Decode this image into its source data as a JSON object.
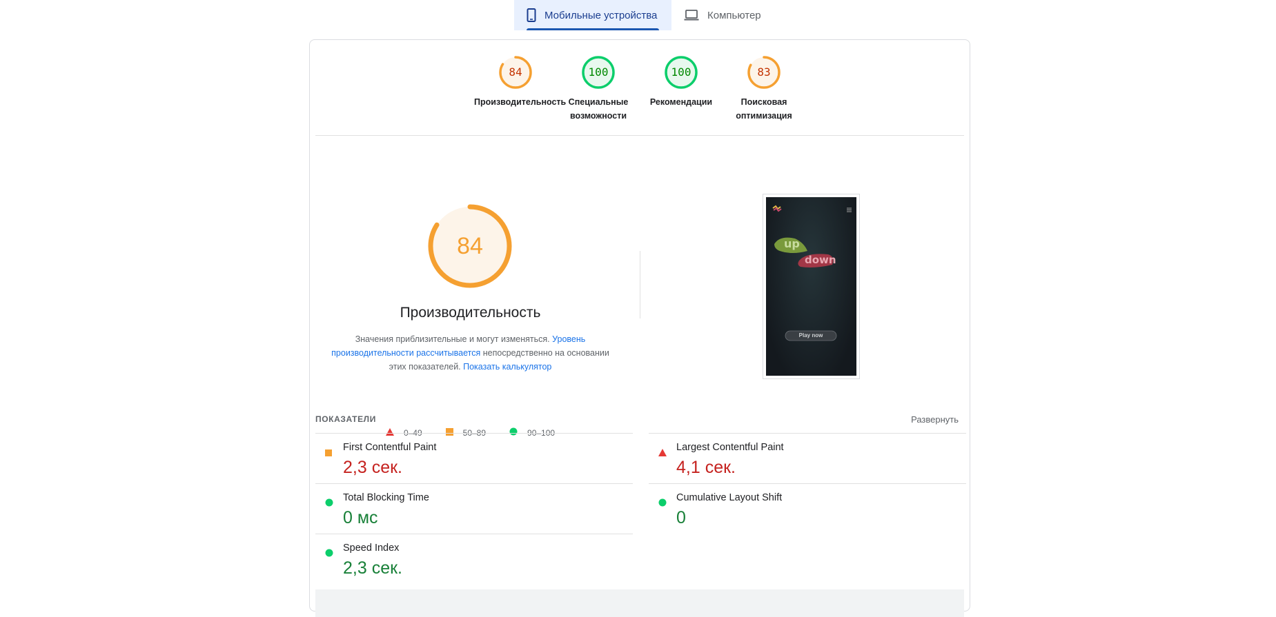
{
  "tabs": [
    {
      "label": "Мобильные устройства",
      "icon": "smartphone-icon",
      "active": true
    },
    {
      "label": "Компьютер",
      "icon": "laptop-icon",
      "active": false
    }
  ],
  "categories": [
    {
      "score": "84",
      "label_line1": "Производительность",
      "label_line2": "",
      "status": "average",
      "color": "#f5a031"
    },
    {
      "score": "100",
      "label_line1": "Специальные",
      "label_line2": "возможности",
      "status": "pass",
      "color": "#0cce6b"
    },
    {
      "score": "100",
      "label_line1": "Рекомендации",
      "label_line2": "",
      "status": "pass",
      "color": "#0cce6b"
    },
    {
      "score": "83",
      "label_line1": "Поисковая",
      "label_line2": "оптимизация",
      "status": "average",
      "color": "#f5a031"
    }
  ],
  "performance": {
    "score": "84",
    "title": "Производительность",
    "desc_part1": "Значения приблизительные и могут изменяться. ",
    "desc_link1": "Уровень производительности рассчитывается",
    "desc_part2": " непосредственно на основании этих показателей. ",
    "desc_link2": "Показать калькулятор"
  },
  "legend": [
    {
      "range": "0–49",
      "shape": "triangle",
      "color": "#e53935"
    },
    {
      "range": "50–89",
      "shape": "square",
      "color": "#f5a031"
    },
    {
      "range": "90–100",
      "shape": "circle",
      "color": "#0cce6b"
    }
  ],
  "screenshot": {
    "word_up": "up",
    "word_down": "down",
    "button": "Play now"
  },
  "metrics_header": "ПОКАЗАТЕЛИ",
  "expand_label": "Развернуть",
  "metrics": [
    {
      "name": "First Contentful Paint",
      "value": "2,3 сек.",
      "status": "average"
    },
    {
      "name": "Largest Contentful Paint",
      "value": "4,1 сек.",
      "status": "fail"
    },
    {
      "name": "Total Blocking Time",
      "value": "0 мс",
      "status": "pass"
    },
    {
      "name": "Cumulative Layout Shift",
      "value": "0",
      "status": "pass"
    },
    {
      "name": "Speed Index",
      "value": "2,3 сек.",
      "status": "pass"
    }
  ],
  "colors": {
    "accent": "#1a73e8",
    "pass": "#0cce6b",
    "average": "#f5a031",
    "fail": "#e53935"
  }
}
